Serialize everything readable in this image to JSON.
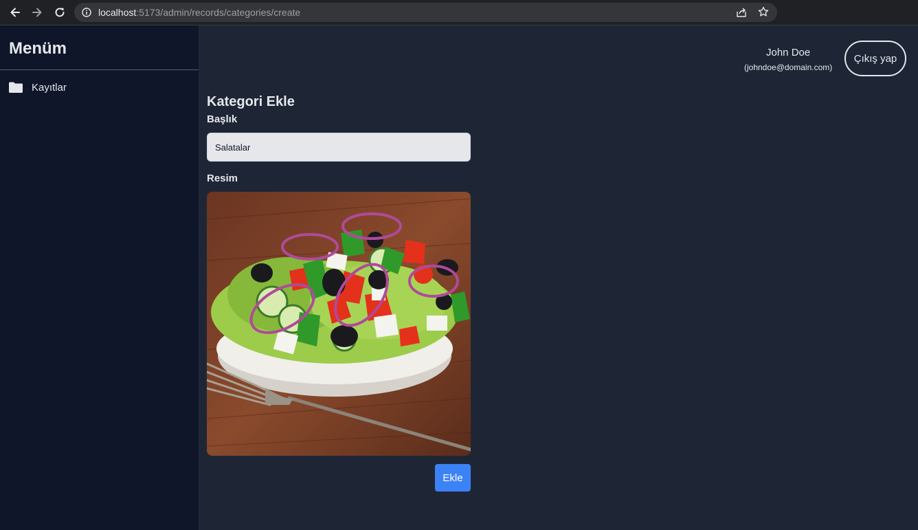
{
  "browser": {
    "url_host": "localhost",
    "url_path": ":5173/admin/records/categories/create"
  },
  "sidebar": {
    "title": "Menüm",
    "items": [
      {
        "label": "Kayıtlar",
        "icon": "folder-icon"
      }
    ]
  },
  "user": {
    "name": "John Doe",
    "email": "(johndoe@domain.com)",
    "logout_label": "Çıkış yap"
  },
  "form": {
    "title": "Kategori Ekle",
    "title_label": "Başlık",
    "title_value": "Salatalar",
    "image_label": "Resim",
    "image_subject": "salad-bowl-photo",
    "submit_label": "Ekle"
  },
  "colors": {
    "page_bg": "#1e2636",
    "sidebar_bg": "#0f1629",
    "accent": "#3b82f6"
  }
}
